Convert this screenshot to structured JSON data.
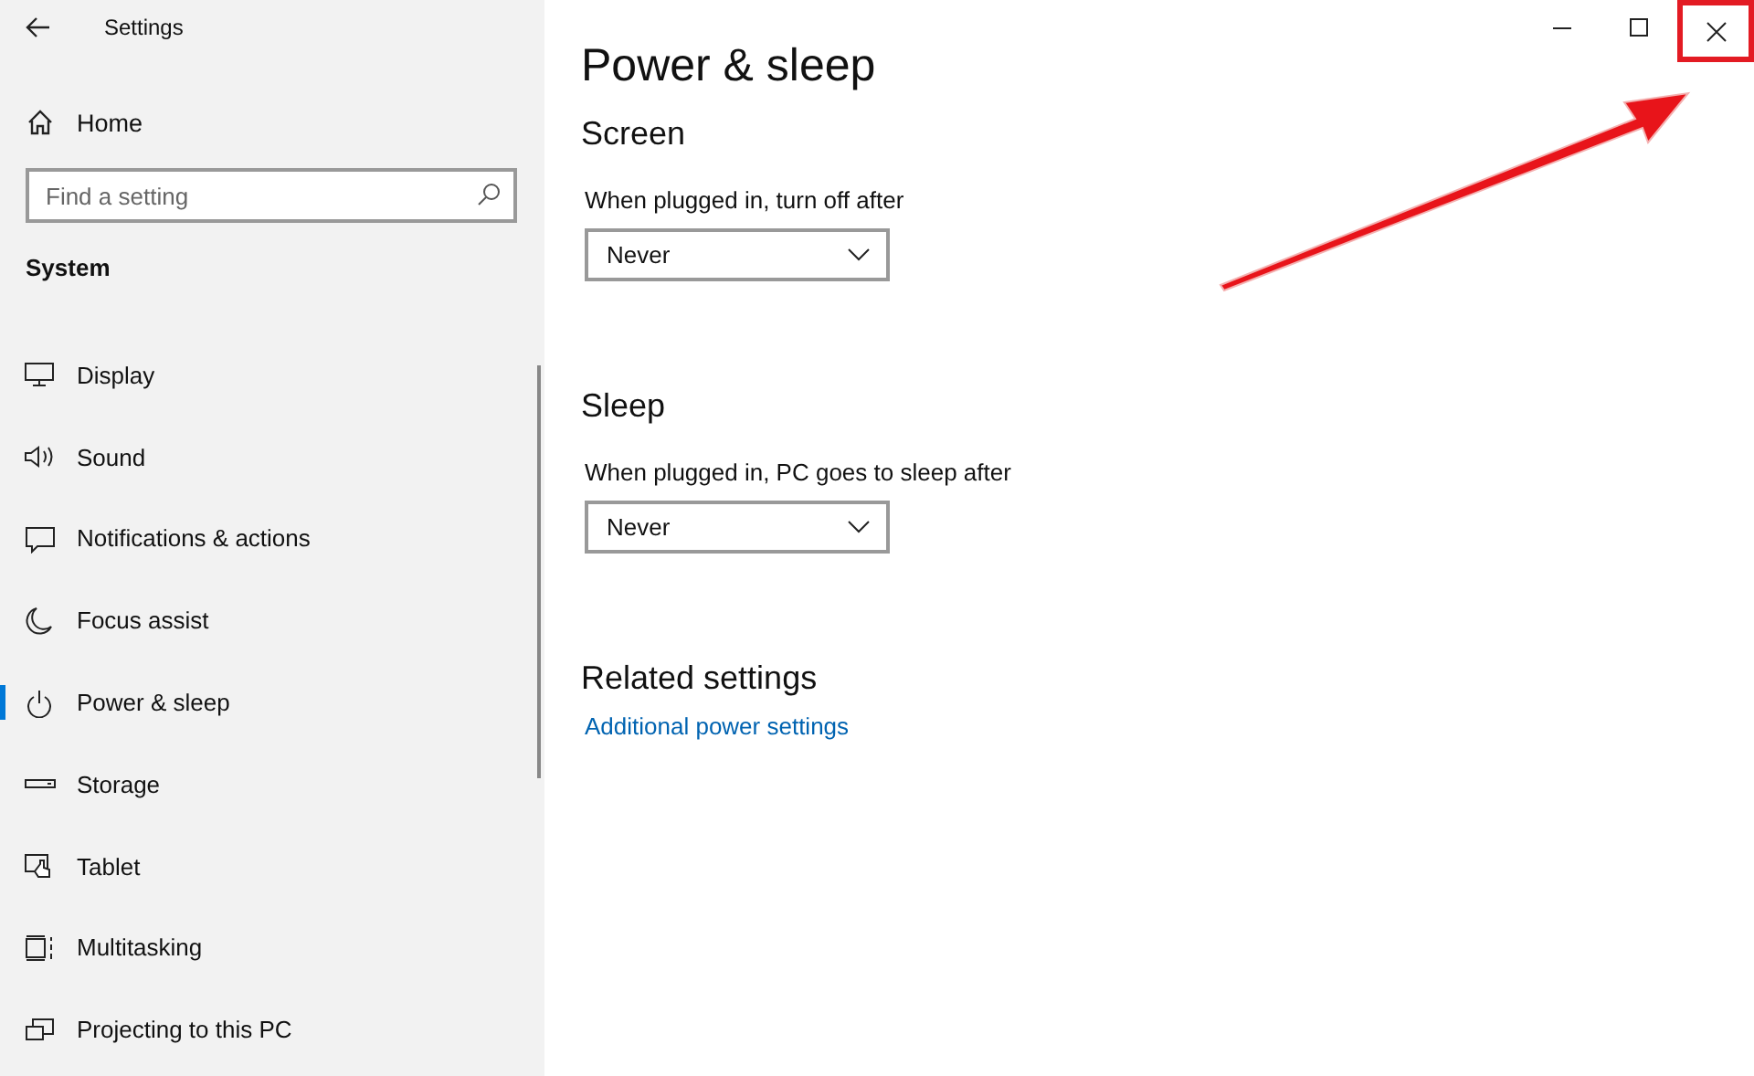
{
  "window": {
    "title": "Settings",
    "close_highlighted": true
  },
  "sidebar": {
    "home": "Home",
    "search": {
      "placeholder": "Find a setting"
    },
    "section": "System",
    "items": [
      {
        "label": "Display",
        "selected": false
      },
      {
        "label": "Sound",
        "selected": false
      },
      {
        "label": "Notifications & actions",
        "selected": false
      },
      {
        "label": "Focus assist",
        "selected": false
      },
      {
        "label": "Power & sleep",
        "selected": true
      },
      {
        "label": "Storage",
        "selected": false
      },
      {
        "label": "Tablet",
        "selected": false
      },
      {
        "label": "Multitasking",
        "selected": false
      },
      {
        "label": "Projecting to this PC",
        "selected": false
      }
    ]
  },
  "page": {
    "title": "Power & sleep",
    "sections": [
      {
        "heading": "Screen",
        "label": "When plugged in, turn off after",
        "value": "Never"
      },
      {
        "heading": "Sleep",
        "label": "When plugged in, PC goes to sleep after",
        "value": "Never"
      }
    ],
    "related": {
      "heading": "Related settings",
      "link": "Additional power settings"
    }
  }
}
